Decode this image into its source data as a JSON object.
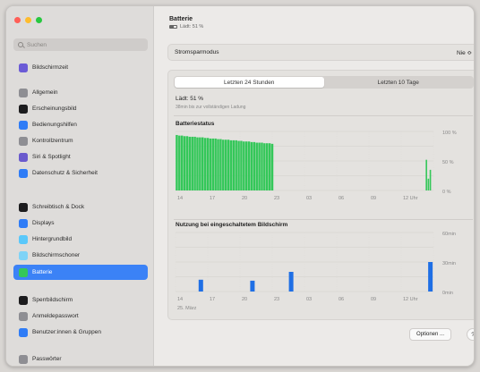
{
  "search": {
    "placeholder": "Suchen"
  },
  "sidebar": {
    "items": [
      {
        "label": "Bildschirmzeit",
        "color": "#6b5bd6",
        "name": "sidebar-item-bildschirmzeit",
        "icon": "hourglass-icon"
      },
      {
        "label": "Allgemein",
        "color": "#8e8e93",
        "name": "sidebar-item-allgemein",
        "icon": "gear-icon"
      },
      {
        "label": "Erscheinungsbild",
        "color": "#1c1c1e",
        "name": "sidebar-item-erscheinungsbild",
        "icon": "appearance-icon"
      },
      {
        "label": "Bedienungshilfen",
        "color": "#2f7cf6",
        "name": "sidebar-item-bedienungshilfen",
        "icon": "accessibility-icon"
      },
      {
        "label": "Kontrollzentrum",
        "color": "#8e8e93",
        "name": "sidebar-item-kontrollzentrum",
        "icon": "control-center-icon"
      },
      {
        "label": "Siri & Spotlight",
        "color": "#6a5acd",
        "name": "sidebar-item-siri-spotlight",
        "icon": "siri-icon"
      },
      {
        "label": "Datenschutz & Sicherheit",
        "color": "#2f7cf6",
        "name": "sidebar-item-datenschutz",
        "icon": "hand-icon"
      },
      {
        "label": "Schreibtisch & Dock",
        "color": "#1c1c1e",
        "name": "sidebar-item-schreibtisch-dock",
        "icon": "dock-icon"
      },
      {
        "label": "Displays",
        "color": "#2f7cf6",
        "name": "sidebar-item-displays",
        "icon": "display-icon"
      },
      {
        "label": "Hintergrundbild",
        "color": "#5ac8fa",
        "name": "sidebar-item-hintergrundbild",
        "icon": "wallpaper-icon"
      },
      {
        "label": "Bildschirmschoner",
        "color": "#7fd3f7",
        "name": "sidebar-item-bildschirmschoner",
        "icon": "screensaver-icon"
      },
      {
        "label": "Batterie",
        "color": "#34c759",
        "name": "sidebar-item-batterie",
        "icon": "battery-icon",
        "selected": true
      },
      {
        "label": "Sperrbildschirm",
        "color": "#1c1c1e",
        "name": "sidebar-item-sperrbildschirm",
        "icon": "lock-icon"
      },
      {
        "label": "Anmeldepasswort",
        "color": "#8e8e93",
        "name": "sidebar-item-anmeldepasswort",
        "icon": "key-icon"
      },
      {
        "label": "Benutzer:innen & Gruppen",
        "color": "#2f7cf6",
        "name": "sidebar-item-benutzer-gruppen",
        "icon": "users-icon"
      },
      {
        "label": "Passwörter",
        "color": "#8e8e93",
        "name": "sidebar-item-passwoerter",
        "icon": "key-icon"
      }
    ]
  },
  "header": {
    "title": "Batterie",
    "subtitle": "Lädt: 51 %"
  },
  "energy": {
    "label": "Stromsparmodus",
    "value": "Nie ≎"
  },
  "tabs": {
    "left": "Letzten 24 Stunden",
    "right": "Letzten 10 Tage"
  },
  "status": {
    "title": "Lädt: 51 %",
    "sub": "38min bis zur vollständigen Ladung"
  },
  "chart_data": [
    {
      "type": "bar",
      "title": "Batteriestatus",
      "x_ticks": [
        "14",
        "17",
        "20",
        "23",
        "03",
        "06",
        "09",
        "12 Uhr"
      ],
      "y_ticks": [
        "100 %",
        "50 %",
        "0 %"
      ],
      "ylim": [
        0,
        100
      ],
      "bar_color": "#34c759",
      "values": [
        94,
        93,
        93,
        92,
        92,
        91,
        91,
        91,
        90,
        90,
        90,
        89,
        89,
        88,
        88,
        88,
        87,
        87,
        86,
        86,
        86,
        85,
        85,
        85,
        84,
        84,
        83,
        83,
        83,
        82,
        82,
        81,
        81,
        81,
        80,
        80,
        80,
        79
      ],
      "late_values": [
        52,
        20,
        35
      ]
    },
    {
      "type": "bar",
      "title": "Nutzung bei eingeschaltetem Bildschirm",
      "x_ticks": [
        "14",
        "17",
        "20",
        "23",
        "03",
        "06",
        "09",
        "12 Uhr"
      ],
      "date_label": "25. März",
      "y_ticks": [
        "60min",
        "30min",
        "0min"
      ],
      "ylim": [
        0,
        60
      ],
      "bar_color": "#1f6fe5",
      "values": [
        12,
        11,
        20,
        30
      ],
      "positions": [
        0.1,
        0.3,
        0.45,
        0.99
      ]
    }
  ],
  "footer": {
    "options": "Optionen ...",
    "help": "?"
  },
  "colors": {
    "red": "#ff5f57",
    "yellow": "#febc2e",
    "green": "#28c840"
  }
}
